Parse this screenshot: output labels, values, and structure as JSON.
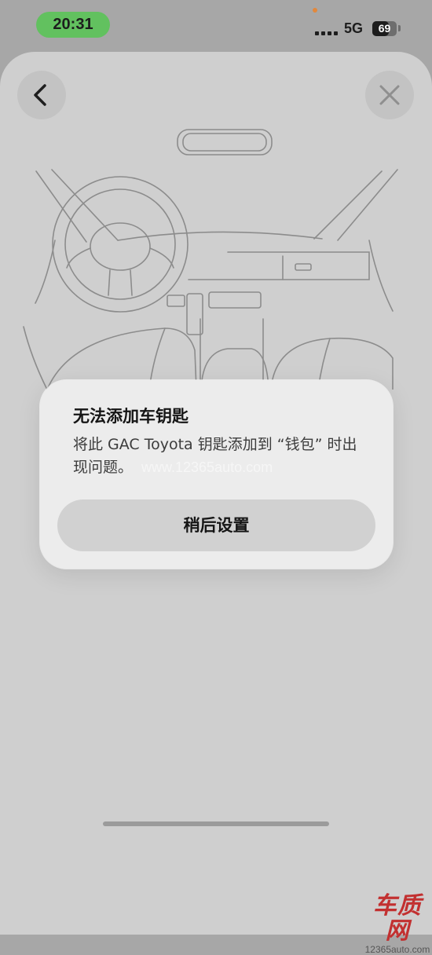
{
  "status_bar": {
    "time": "20:31",
    "network": "5G",
    "battery_level": "69",
    "battery_fraction": 0.69,
    "time_pill_color": "#62c15f"
  },
  "navigation": {
    "back_icon": "chevron-left-icon",
    "close_icon": "close-x-icon"
  },
  "alert": {
    "title": "无法添加车钥匙",
    "message": "将此 GAC Toyota 钥匙添加到 “钱包” 时出现问题。",
    "button_label": "稍后设置"
  },
  "watermark": {
    "url_overlay": "www.12365auto.com",
    "logo_text": "车质网",
    "logo_url": "12365auto.com",
    "logo_color": "#c23030"
  },
  "colors": {
    "sheet_background": "#cfcfcf",
    "alert_background": "#ececec",
    "button_background": "#d1d1d1"
  }
}
